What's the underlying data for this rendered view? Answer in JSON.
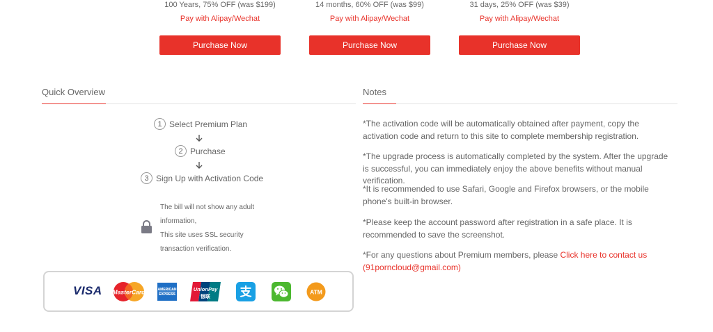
{
  "plans": [
    {
      "desc": "100 Years, 75% OFF (was $199)",
      "pay": "Pay with Alipay/Wechat",
      "button": "Purchase Now"
    },
    {
      "desc": "14 months, 60% OFF (was $99)",
      "pay": "Pay with Alipay/Wechat",
      "button": "Purchase Now"
    },
    {
      "desc": "31 days, 25% OFF (was $39)",
      "pay": "Pay with Alipay/Wechat",
      "button": "Purchase Now"
    }
  ],
  "overview": {
    "title": "Quick Overview",
    "steps": [
      {
        "num": "1",
        "label": "Select Premium Plan"
      },
      {
        "num": "2",
        "label": "Purchase"
      },
      {
        "num": "3",
        "label": "Sign Up with Activation Code"
      }
    ],
    "bill_lines": [
      "The bill will not show any adult",
      "information,",
      "This site uses SSL security",
      "transaction verification."
    ]
  },
  "notes": {
    "title": "Notes",
    "items": [
      "*The activation code will be automatically obtained after payment, copy the activation code and return to this site to complete membership registration.",
      "*The upgrade process is automatically completed by the system. After the upgrade is successful, you can immediately enjoy the above benefits without manual verification.",
      "*It is recommended to use Safari, Google and Firefox browsers, or the mobile phone's built-in browser.",
      "*Please keep the account password after registration in a safe place. It is recommended to save the screenshot."
    ],
    "contact_prefix": "*For any questions about Premium members, please ",
    "contact_link": "Click here to contact us",
    "contact_email": "(91porncloud@gmail.com)"
  },
  "payments": {
    "visa": "VISA",
    "mastercard": "MasterCard",
    "amex_top": "AMERICAN",
    "amex_bottom": "EXPRESS",
    "unionpay": "UnionPay",
    "unionpay_cn": "银联",
    "alipay_glyph": "支",
    "atm": "ATM"
  },
  "colors": {
    "accent": "#e8322a",
    "text": "#666666",
    "divider": "#e4e4e4"
  }
}
